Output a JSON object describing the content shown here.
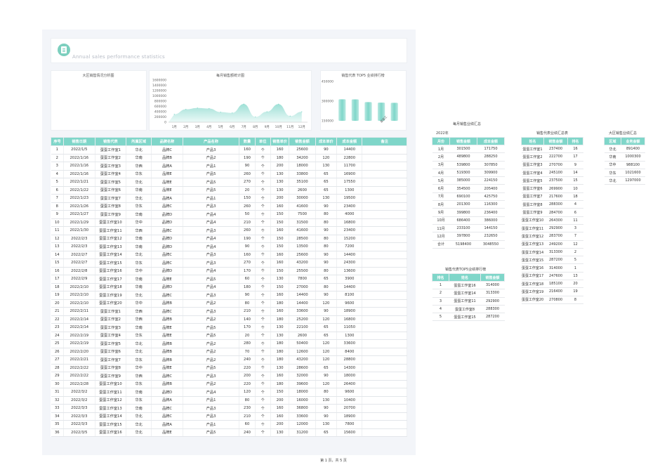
{
  "header": {
    "title": "Annual sales performance statistics",
    "logo_icon": "clipboard-icon"
  },
  "charts": {
    "region_title": "大区销售情况分析图",
    "monthly_title": "每月销售额统计图",
    "top5_title": "销售代表 TOP5 业绩排行榜"
  },
  "chart_data": [
    {
      "type": "area",
      "title": "每月销售额统计图",
      "categories": [
        "1月",
        "2月",
        "3月",
        "4月",
        "5月",
        "6月",
        "7月",
        "8月",
        "9月",
        "10月",
        "11月",
        "12月"
      ],
      "values": [
        301500,
        489800,
        539800,
        519300,
        385000,
        354500,
        690100,
        201300,
        399800,
        686400,
        233100,
        397800
      ],
      "yticks": [
        "1600000",
        "1400000",
        "1200000",
        "1000000",
        "800000",
        "600000",
        "400000",
        "200000",
        "0"
      ],
      "ylim": [
        0,
        1600000
      ],
      "color": "#7fd6c9"
    },
    {
      "type": "bar",
      "title": "销售代表 TOP5 业绩排行榜",
      "categories": [
        "蛋蛋工作室16",
        "蛋蛋工作室14",
        "蛋蛋工作室11",
        "蛋蛋工作室8",
        "蛋蛋工作室15"
      ],
      "values": [
        314000,
        313300,
        292900,
        288300,
        287200
      ],
      "yticks": [
        "450000",
        "300000",
        "150000"
      ],
      "ylim": [
        150000,
        450000
      ],
      "visible_xlabel": "蛋蛋工",
      "color": "#7fd6c9"
    }
  ],
  "main_table": {
    "columns": [
      "序号",
      "销售日期",
      "销售代表",
      "所属区域",
      "品牌名称",
      "产品名称",
      "数量",
      "单位",
      "销售单价",
      "销售金额",
      "成本单价",
      "成本金额",
      "备注"
    ],
    "rows": [
      [
        "1",
        "2022/1/5",
        "蛋蛋工作室1",
        "华北",
        "品牌C",
        "产品3",
        "160",
        "个",
        "160",
        "25600",
        "90",
        "14400",
        ""
      ],
      [
        "2",
        "2022/1/16",
        "蛋蛋工作室2",
        "华南",
        "品牌B",
        "产品2",
        "190",
        "个",
        "180",
        "34200",
        "120",
        "22800",
        ""
      ],
      [
        "3",
        "2022/1/16",
        "蛋蛋工作室3",
        "华西",
        "品牌A",
        "产品1",
        "90",
        "个",
        "200",
        "18000",
        "130",
        "11700",
        ""
      ],
      [
        "4",
        "2022/1/16",
        "蛋蛋工作室4",
        "华东",
        "品牌E",
        "产品5",
        "260",
        "个",
        "130",
        "33800",
        "65",
        "16900",
        ""
      ],
      [
        "5",
        "2022/1/21",
        "蛋蛋工作室5",
        "华北",
        "品牌E",
        "产品5",
        "270",
        "个",
        "130",
        "35100",
        "65",
        "17550",
        ""
      ],
      [
        "6",
        "2022/1/22",
        "蛋蛋工作室6",
        "华南",
        "品牌E",
        "产品5",
        "20",
        "个",
        "130",
        "2600",
        "65",
        "1300",
        ""
      ],
      [
        "7",
        "2022/1/23",
        "蛋蛋工作室7",
        "华北",
        "品牌A",
        "产品1",
        "150",
        "个",
        "200",
        "30000",
        "130",
        "19500",
        ""
      ],
      [
        "8",
        "2022/1/26",
        "蛋蛋工作室8",
        "华东",
        "品牌C",
        "产品3",
        "260",
        "个",
        "160",
        "41600",
        "90",
        "23400",
        ""
      ],
      [
        "9",
        "2022/1/27",
        "蛋蛋工作室9",
        "华南",
        "品牌D",
        "产品4",
        "50",
        "个",
        "150",
        "7500",
        "80",
        "4000",
        ""
      ],
      [
        "10",
        "2022/1/29",
        "蛋蛋工作室10",
        "华中",
        "品牌D",
        "产品4",
        "210",
        "个",
        "150",
        "31500",
        "80",
        "16800",
        ""
      ],
      [
        "11",
        "2022/1/30",
        "蛋蛋工作室11",
        "华西",
        "品牌C",
        "产品3",
        "260",
        "个",
        "160",
        "41600",
        "90",
        "23400",
        ""
      ],
      [
        "12",
        "2022/2/3",
        "蛋蛋工作室12",
        "华南",
        "品牌D",
        "产品4",
        "190",
        "个",
        "150",
        "28500",
        "80",
        "15200",
        ""
      ],
      [
        "13",
        "2022/2/3",
        "蛋蛋工作室13",
        "华南",
        "品牌D",
        "产品4",
        "90",
        "个",
        "150",
        "13500",
        "80",
        "7200",
        ""
      ],
      [
        "14",
        "2022/2/7",
        "蛋蛋工作室14",
        "华北",
        "品牌C",
        "产品3",
        "160",
        "个",
        "160",
        "25600",
        "90",
        "14400",
        ""
      ],
      [
        "15",
        "2022/2/7",
        "蛋蛋工作室15",
        "华东",
        "品牌C",
        "产品3",
        "270",
        "个",
        "160",
        "43200",
        "90",
        "24300",
        ""
      ],
      [
        "16",
        "2022/2/8",
        "蛋蛋工作室16",
        "华中",
        "品牌D",
        "产品4",
        "170",
        "个",
        "150",
        "25500",
        "80",
        "13600",
        ""
      ],
      [
        "17",
        "2022/2/9",
        "蛋蛋工作室17",
        "华南",
        "品牌E",
        "产品5",
        "60",
        "个",
        "130",
        "7800",
        "65",
        "3900",
        ""
      ],
      [
        "18",
        "2022/2/10",
        "蛋蛋工作室18",
        "华南",
        "品牌D",
        "产品4",
        "180",
        "个",
        "150",
        "27000",
        "80",
        "14400",
        ""
      ],
      [
        "19",
        "2022/2/10",
        "蛋蛋工作室19",
        "华北",
        "品牌C",
        "产品3",
        "90",
        "个",
        "160",
        "14400",
        "90",
        "8100",
        ""
      ],
      [
        "20",
        "2022/2/10",
        "蛋蛋工作室20",
        "华中",
        "品牌B",
        "产品2",
        "80",
        "个",
        "180",
        "14400",
        "120",
        "9600",
        ""
      ],
      [
        "21",
        "2022/2/11",
        "蛋蛋工作室1",
        "华西",
        "品牌C",
        "产品3",
        "210",
        "个",
        "160",
        "33600",
        "90",
        "18900",
        ""
      ],
      [
        "22",
        "2022/2/14",
        "蛋蛋工作室2",
        "华西",
        "品牌B",
        "产品2",
        "140",
        "个",
        "180",
        "25200",
        "120",
        "16800",
        ""
      ],
      [
        "23",
        "2022/2/14",
        "蛋蛋工作室3",
        "华南",
        "品牌E",
        "产品5",
        "170",
        "个",
        "130",
        "22100",
        "65",
        "11050",
        ""
      ],
      [
        "24",
        "2022/2/19",
        "蛋蛋工作室4",
        "华东",
        "品牌E",
        "产品5",
        "20",
        "个",
        "130",
        "2600",
        "65",
        "1300",
        ""
      ],
      [
        "25",
        "2022/2/19",
        "蛋蛋工作室5",
        "华北",
        "品牌B",
        "产品2",
        "280",
        "个",
        "180",
        "50400",
        "120",
        "33600",
        ""
      ],
      [
        "26",
        "2022/2/20",
        "蛋蛋工作室6",
        "华北",
        "品牌B",
        "产品2",
        "70",
        "个",
        "180",
        "12600",
        "120",
        "8400",
        ""
      ],
      [
        "27",
        "2022/2/21",
        "蛋蛋工作室7",
        "华东",
        "品牌B",
        "产品2",
        "240",
        "个",
        "180",
        "43200",
        "120",
        "28800",
        ""
      ],
      [
        "28",
        "2022/2/22",
        "蛋蛋工作室8",
        "华中",
        "品牌E",
        "产品5",
        "220",
        "个",
        "130",
        "28600",
        "65",
        "14300",
        ""
      ],
      [
        "29",
        "2022/2/22",
        "蛋蛋工作室9",
        "华西",
        "品牌C",
        "产品3",
        "200",
        "个",
        "160",
        "32000",
        "90",
        "18000",
        ""
      ],
      [
        "30",
        "2022/2/28",
        "蛋蛋工作室10",
        "华东",
        "品牌B",
        "产品2",
        "220",
        "个",
        "180",
        "39600",
        "120",
        "26400",
        ""
      ],
      [
        "31",
        "2022/3/2",
        "蛋蛋工作室11",
        "华南",
        "品牌D",
        "产品4",
        "120",
        "个",
        "150",
        "18000",
        "80",
        "9600",
        ""
      ],
      [
        "32",
        "2022/3/2",
        "蛋蛋工作室12",
        "华东",
        "品牌A",
        "产品1",
        "80",
        "个",
        "200",
        "16000",
        "130",
        "10400",
        ""
      ],
      [
        "33",
        "2022/3/3",
        "蛋蛋工作室13",
        "华南",
        "品牌C",
        "产品3",
        "230",
        "个",
        "160",
        "36800",
        "90",
        "20700",
        ""
      ],
      [
        "34",
        "2022/3/3",
        "蛋蛋工作室14",
        "华北",
        "品牌C",
        "产品3",
        "210",
        "个",
        "160",
        "33600",
        "90",
        "18900",
        ""
      ],
      [
        "35",
        "2022/3/3",
        "蛋蛋工作室15",
        "华北",
        "品牌A",
        "产品1",
        "60",
        "个",
        "200",
        "12000",
        "130",
        "7800",
        ""
      ],
      [
        "36",
        "2022/3/5",
        "蛋蛋工作室16",
        "华北",
        "品牌E",
        "产品5",
        "240",
        "个",
        "130",
        "31200",
        "65",
        "15600",
        ""
      ]
    ]
  },
  "monthly_summary": {
    "title": "每月销售业绩汇总",
    "year": "2022年",
    "columns": [
      "月份",
      "销售金额",
      "成本金额"
    ],
    "rows": [
      [
        "1月",
        "301500",
        "171750"
      ],
      [
        "2月",
        "489800",
        "288250"
      ],
      [
        "3月",
        "539800",
        "307850"
      ],
      [
        "4月",
        "519300",
        "309900"
      ],
      [
        "5月",
        "385000",
        "224150"
      ],
      [
        "6月",
        "354500",
        "205400"
      ],
      [
        "7月",
        "690100",
        "425750"
      ],
      [
        "8月",
        "201300",
        "116300"
      ],
      [
        "9月",
        "399800",
        "236400"
      ],
      [
        "10月",
        "686400",
        "386000"
      ],
      [
        "11月",
        "233100",
        "144150"
      ],
      [
        "12月",
        "397800",
        "232650"
      ],
      [
        "合计",
        "5198400",
        "3048550"
      ]
    ]
  },
  "top5_table": {
    "title": "销售代表TOP5业绩排行榜",
    "columns": [
      "排名",
      "姓名",
      "销售金额"
    ],
    "rows": [
      [
        "1",
        "蛋蛋工作室16",
        "314000"
      ],
      [
        "2",
        "蛋蛋工作室14",
        "313300"
      ],
      [
        "3",
        "蛋蛋工作室11",
        "292900"
      ],
      [
        "4",
        "蛋蛋工作室8",
        "288300"
      ],
      [
        "5",
        "蛋蛋工作室15",
        "287200"
      ]
    ]
  },
  "rep_summary": {
    "title": "销售代表业绩汇总表",
    "columns": [
      "姓名",
      "销售金额",
      "排名"
    ],
    "rows": [
      [
        "蛋蛋工作室1",
        "237400",
        "16"
      ],
      [
        "蛋蛋工作室2",
        "222700",
        "17"
      ],
      [
        "蛋蛋工作室3",
        "270700",
        "9"
      ],
      [
        "蛋蛋工作室4",
        "245100",
        "14"
      ],
      [
        "蛋蛋工作室5",
        "237500",
        "15"
      ],
      [
        "蛋蛋工作室6",
        "269900",
        "10"
      ],
      [
        "蛋蛋工作室7",
        "217600",
        "18"
      ],
      [
        "蛋蛋工作室8",
        "288300",
        "4"
      ],
      [
        "蛋蛋工作室9",
        "284700",
        "6"
      ],
      [
        "蛋蛋工作室10",
        "264300",
        "11"
      ],
      [
        "蛋蛋工作室11",
        "292900",
        "3"
      ],
      [
        "蛋蛋工作室12",
        "283700",
        "7"
      ],
      [
        "蛋蛋工作室13",
        "249200",
        "12"
      ],
      [
        "蛋蛋工作室14",
        "313300",
        "2"
      ],
      [
        "蛋蛋工作室15",
        "287200",
        "5"
      ],
      [
        "蛋蛋工作室16",
        "314000",
        "1"
      ],
      [
        "蛋蛋工作室17",
        "247600",
        "13"
      ],
      [
        "蛋蛋工作室18",
        "185100",
        "20"
      ],
      [
        "蛋蛋工作室19",
        "216400",
        "19"
      ],
      [
        "蛋蛋工作室20",
        "270800",
        "8"
      ]
    ]
  },
  "region_summary": {
    "title": "大区销售业绩汇总",
    "columns": [
      "区域",
      "业务金额"
    ],
    "rows": [
      [
        "华北",
        "891400"
      ],
      [
        "华南",
        "1000300"
      ],
      [
        "华中",
        "988100"
      ],
      [
        "华东",
        "1021600"
      ],
      [
        "华北",
        "1297000"
      ]
    ]
  },
  "footer": {
    "page": "第 1 页，共 5 页"
  },
  "colors": {
    "accent": "#7fd6c9",
    "panel": "#f3f5f9"
  }
}
